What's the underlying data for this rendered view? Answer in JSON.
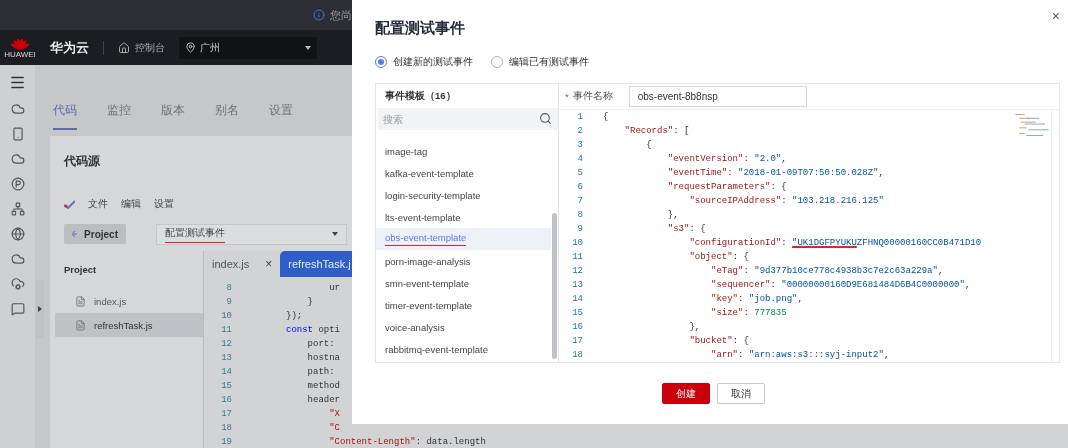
{
  "notice": {
    "text": "您尚"
  },
  "header": {
    "logo_caption": "HUAWEI",
    "brand": "华为云",
    "console": "控制台",
    "region": "广州"
  },
  "tabs": [
    {
      "label": "代码",
      "selected": true
    },
    {
      "label": "监控",
      "selected": false
    },
    {
      "label": "版本",
      "selected": false
    },
    {
      "label": "别名",
      "selected": false
    },
    {
      "label": "设置",
      "selected": false
    }
  ],
  "code_source": {
    "title": "代码源",
    "menu": [
      "文件",
      "编辑",
      "设置"
    ],
    "project_button": "Project",
    "event_select": "配置测试事件",
    "project_panel": {
      "title": "Project",
      "files": [
        {
          "name": "index.js",
          "selected": false
        },
        {
          "name": "refreshTask.js",
          "selected": true
        }
      ]
    },
    "editor": {
      "tabs": [
        {
          "label": "index.js",
          "selected": false,
          "close": "×"
        },
        {
          "label": "refreshTask.j",
          "selected": true
        }
      ],
      "lines": [
        {
          "no": "8",
          "tokens": [
            {
              "kind": "plain",
              "text": "        ur"
            }
          ]
        },
        {
          "no": "9",
          "tokens": [
            {
              "kind": "plain",
              "text": "    }"
            }
          ]
        },
        {
          "no": "10",
          "tokens": [
            {
              "kind": "plain",
              "text": "});"
            }
          ]
        },
        {
          "no": "11",
          "tokens": [
            {
              "kind": "kw",
              "text": "const"
            },
            {
              "kind": "plain",
              "text": " opti"
            }
          ]
        },
        {
          "no": "12",
          "tokens": [
            {
              "kind": "plain",
              "text": "    port:"
            }
          ]
        },
        {
          "no": "13",
          "tokens": [
            {
              "kind": "plain",
              "text": "    hostna"
            }
          ]
        },
        {
          "no": "14",
          "tokens": [
            {
              "kind": "plain",
              "text": "    path:"
            }
          ]
        },
        {
          "no": "15",
          "tokens": [
            {
              "kind": "plain",
              "text": "    method"
            }
          ]
        },
        {
          "no": "16",
          "tokens": [
            {
              "kind": "plain",
              "text": "    header"
            }
          ]
        },
        {
          "no": "17",
          "tokens": [
            {
              "kind": "key",
              "text": "        \"X"
            }
          ]
        },
        {
          "no": "18",
          "tokens": [
            {
              "kind": "key",
              "text": "        \"C"
            }
          ]
        },
        {
          "no": "19",
          "tokens": [
            {
              "kind": "key",
              "text": "        \"Content-Length\""
            },
            {
              "kind": "plain",
              "text": ": data.length"
            }
          ]
        }
      ]
    }
  },
  "dialog": {
    "title": "配置测试事件",
    "close": "×",
    "modes": [
      {
        "label": "创建新的测试事件",
        "selected": true
      },
      {
        "label": "编辑已有测试事件",
        "selected": false
      }
    ],
    "templates": {
      "title": "事件模板（16）",
      "placeholder": "搜索",
      "items": [
        {
          "name": "image-tag",
          "selected": false
        },
        {
          "name": "kafka-event-template",
          "selected": false
        },
        {
          "name": "login-security-template",
          "selected": false
        },
        {
          "name": "lts-event-template",
          "selected": false
        },
        {
          "name": "obs-event-template",
          "selected": true
        },
        {
          "name": "porn-image-analysis",
          "selected": false
        },
        {
          "name": "smn-event-template",
          "selected": false
        },
        {
          "name": "timer-event-template",
          "selected": false
        },
        {
          "name": "voice-analysis",
          "selected": false
        },
        {
          "name": "rabbitmq-event-template",
          "selected": false
        }
      ]
    },
    "event_name": {
      "required_mark": "*",
      "label": "事件名称",
      "value": "obs-event-8b8nsp"
    },
    "editor": {
      "lines": [
        {
          "no": "1",
          "tokens": [
            {
              "kind": "punct",
              "text": "{"
            }
          ]
        },
        {
          "no": "2",
          "tokens": [
            {
              "kind": "key",
              "text": "    \"Records\""
            },
            {
              "kind": "punct",
              "text": ": ["
            }
          ]
        },
        {
          "no": "3",
          "tokens": [
            {
              "kind": "punct",
              "text": "        {"
            }
          ]
        },
        {
          "no": "4",
          "tokens": [
            {
              "kind": "key",
              "text": "            \"eventVersion\""
            },
            {
              "kind": "punct",
              "text": ": "
            },
            {
              "kind": "str",
              "text": "\"2.0\""
            },
            {
              "kind": "punct",
              "text": ","
            }
          ]
        },
        {
          "no": "5",
          "tokens": [
            {
              "kind": "key",
              "text": "            \"eventTime\""
            },
            {
              "kind": "punct",
              "text": ": "
            },
            {
              "kind": "str",
              "text": "\"2018-01-09T07:50:50.028Z\""
            },
            {
              "kind": "punct",
              "text": ","
            }
          ]
        },
        {
          "no": "6",
          "tokens": [
            {
              "kind": "key",
              "text": "            \"requestParameters\""
            },
            {
              "kind": "punct",
              "text": ": {"
            }
          ]
        },
        {
          "no": "7",
          "tokens": [
            {
              "kind": "key",
              "text": "                \"sourceIPAddress\""
            },
            {
              "kind": "punct",
              "text": ": "
            },
            {
              "kind": "str",
              "text": "\"103.218.216.125\""
            }
          ]
        },
        {
          "no": "8",
          "tokens": [
            {
              "kind": "punct",
              "text": "            },"
            }
          ]
        },
        {
          "no": "9",
          "tokens": [
            {
              "kind": "key",
              "text": "            \"s3\""
            },
            {
              "kind": "punct",
              "text": ": {"
            }
          ]
        },
        {
          "no": "10",
          "tokens": [
            {
              "kind": "key",
              "text": "                \"configurationId\""
            },
            {
              "kind": "punct",
              "text": ": "
            },
            {
              "kind": "struck",
              "text": "\"UK1DGFPYUKU"
            },
            {
              "kind": "str",
              "text": "ZFHNQ00000160CC0B471D10"
            }
          ]
        },
        {
          "no": "11",
          "tokens": [
            {
              "kind": "key",
              "text": "                \"object\""
            },
            {
              "kind": "punct",
              "text": ": {"
            }
          ]
        },
        {
          "no": "12",
          "tokens": [
            {
              "kind": "key",
              "text": "                    \"eTag\""
            },
            {
              "kind": "punct",
              "text": ": "
            },
            {
              "kind": "str",
              "text": "\"9d377b10ce778c4938b3c7e2c63a229a\""
            },
            {
              "kind": "punct",
              "text": ","
            }
          ]
        },
        {
          "no": "13",
          "tokens": [
            {
              "kind": "key",
              "text": "                    \"sequencer\""
            },
            {
              "kind": "punct",
              "text": ": "
            },
            {
              "kind": "str",
              "text": "\"00000000160D9E681484D6B4C0000000\""
            },
            {
              "kind": "punct",
              "text": ","
            }
          ]
        },
        {
          "no": "14",
          "tokens": [
            {
              "kind": "key",
              "text": "                    \"key\""
            },
            {
              "kind": "punct",
              "text": ": "
            },
            {
              "kind": "str",
              "text": "\"job.png\""
            },
            {
              "kind": "punct",
              "text": ","
            }
          ]
        },
        {
          "no": "15",
          "tokens": [
            {
              "kind": "key",
              "text": "                    \"size\""
            },
            {
              "kind": "punct",
              "text": ": "
            },
            {
              "kind": "num",
              "text": "777835"
            }
          ]
        },
        {
          "no": "16",
          "tokens": [
            {
              "kind": "punct",
              "text": "                },"
            }
          ]
        },
        {
          "no": "17",
          "tokens": [
            {
              "kind": "key",
              "text": "                \"bucket\""
            },
            {
              "kind": "punct",
              "text": ": {"
            }
          ]
        },
        {
          "no": "18",
          "tokens": [
            {
              "kind": "key",
              "text": "                    \"arn\""
            },
            {
              "kind": "punct",
              "text": ": "
            },
            {
              "kind": "str",
              "text": "\"arn:aws:s3:::syj-input2\""
            },
            {
              "kind": "punct",
              "text": ","
            }
          ]
        }
      ]
    },
    "buttons": [
      {
        "label": "创建",
        "kind": "primary"
      },
      {
        "label": "取消",
        "kind": "secondary"
      }
    ]
  }
}
